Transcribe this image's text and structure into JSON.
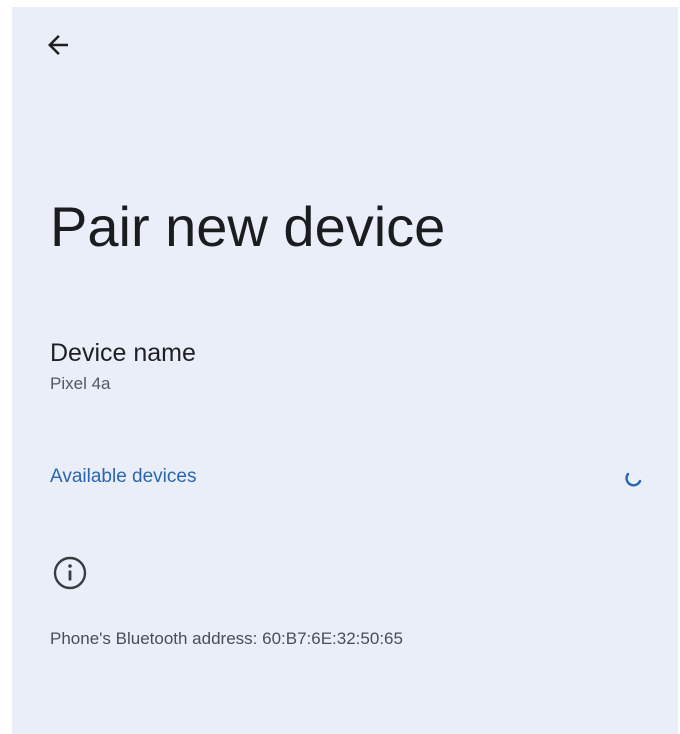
{
  "toolbar": {
    "back_icon": "arrow-back-icon"
  },
  "header": {
    "title": "Pair new device"
  },
  "device_name": {
    "label": "Device name",
    "value": "Pixel 4a"
  },
  "available_devices": {
    "label": "Available devices",
    "status_icon": "loading-spinner-icon"
  },
  "footer": {
    "info_icon": "info-icon",
    "bluetooth_address": "Phone's Bluetooth address: 60:B7:6E:32:50:65"
  },
  "colors": {
    "background": "#e9eef8",
    "accent": "#2a66b0",
    "text_primary": "#1b1c20",
    "text_secondary": "#55585f"
  }
}
